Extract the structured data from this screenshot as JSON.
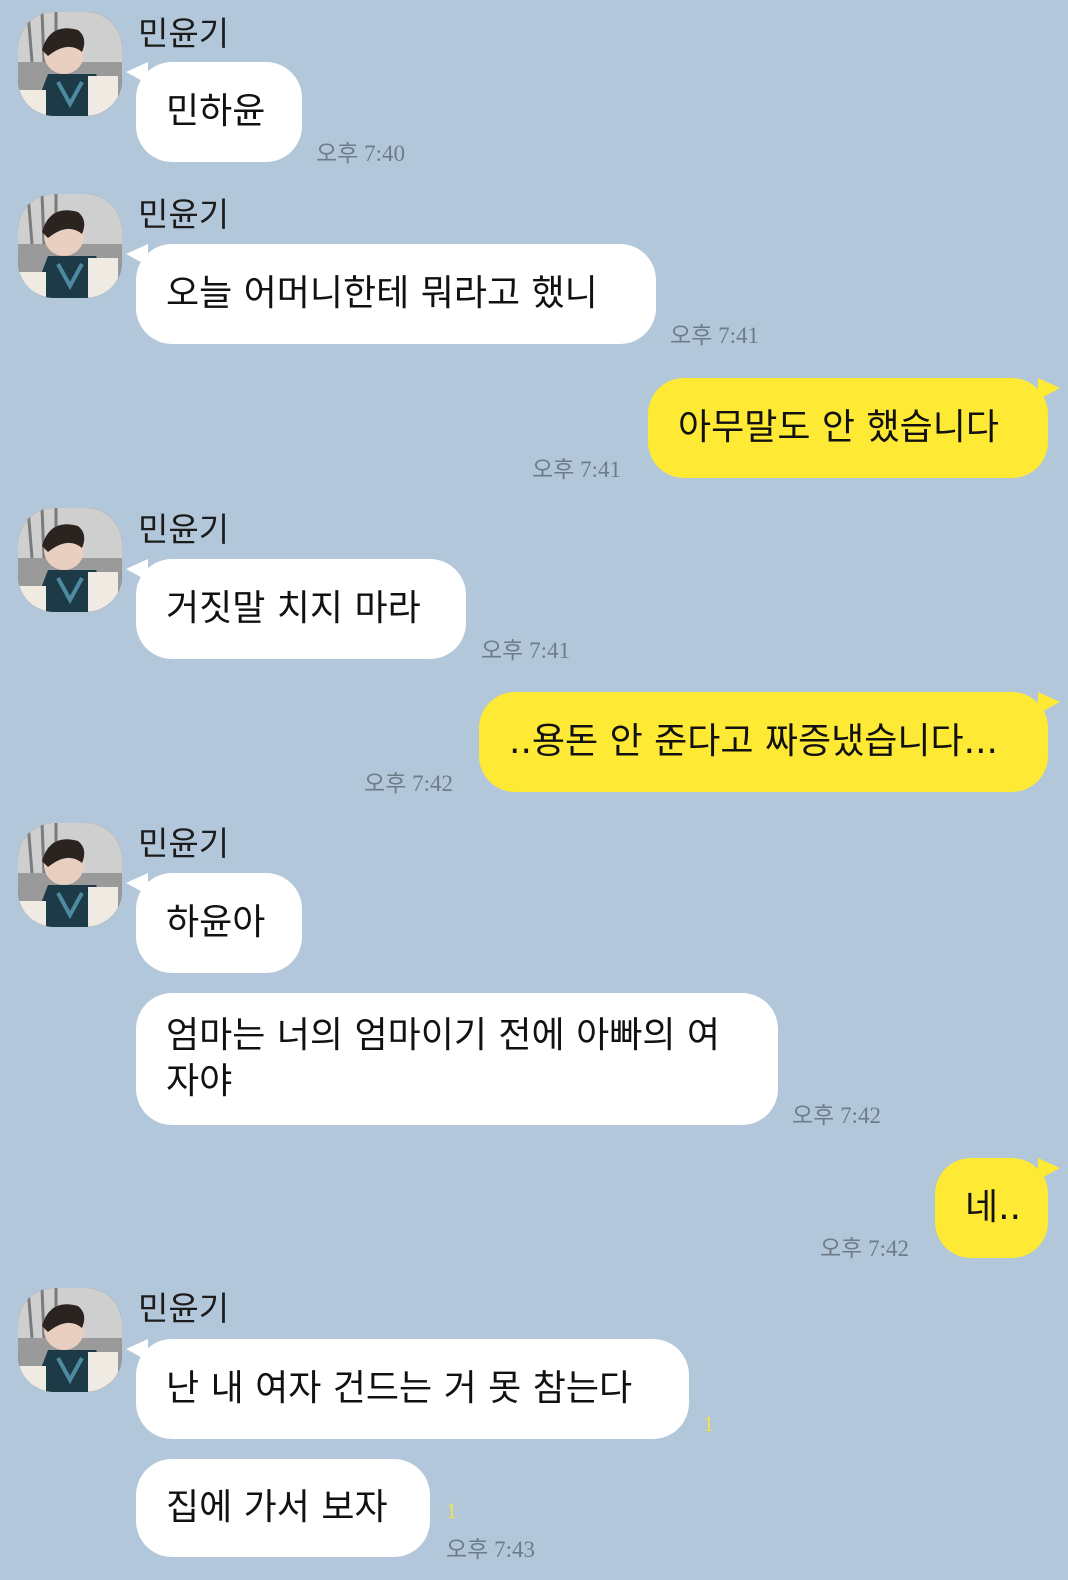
{
  "sender_name": "민윤기",
  "messages": [
    {
      "text": "민하윤",
      "time": "오후 7:40"
    },
    {
      "text": "오늘 어머니한테 뭐라고 했니",
      "time": "오후 7:41"
    },
    {
      "text": "아무말도 안 했습니다",
      "time": "오후 7:41"
    },
    {
      "text": "거짓말 치지 마라",
      "time": "오후 7:41"
    },
    {
      "text": "..용돈 안 준다고 짜증냈습니다...",
      "time": "오후 7:42"
    },
    {
      "text": "하윤아"
    },
    {
      "text": "엄마는 너의 엄마이기 전에 아빠의 여자야",
      "time": "오후 7:42"
    },
    {
      "text": "네..",
      "time": "오후 7:42"
    },
    {
      "text": "난 내 여자 건드는 거 못 참는다",
      "unread": "1"
    },
    {
      "text": "집에 가서 보자",
      "unread": "1",
      "time": "오후 7:43"
    }
  ],
  "colors": {
    "background": "#b2c7da",
    "incoming_bubble": "#ffffff",
    "outgoing_bubble": "#fee934",
    "timestamp": "#6f7c88",
    "unread_count": "#f4e24a"
  },
  "icons": {
    "avatar": "profile-photo-avatar"
  }
}
